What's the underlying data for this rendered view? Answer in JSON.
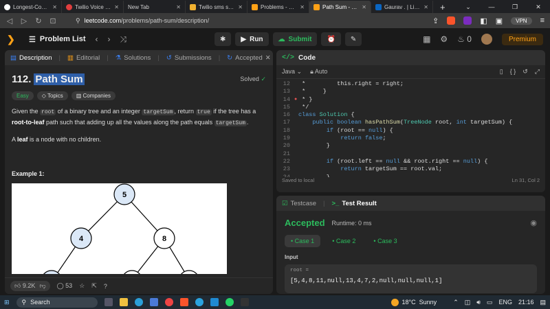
{
  "browser": {
    "tabs": [
      {
        "title": "Longest-Compound",
        "color": "#ffffff"
      },
      {
        "title": "Twilio Voice SDKs -",
        "color": "#e03e3e"
      },
      {
        "title": "New Tab",
        "color": "#333333"
      },
      {
        "title": "Twilio sms sender a",
        "color": "#f0b030"
      },
      {
        "title": "Problems - LeetCod",
        "color": "#ffa116"
      },
      {
        "title": "Path Sum - Leet",
        "color": "#ffa116"
      },
      {
        "title": "Gaurav . | LinkedIn",
        "color": "#0a66c2"
      }
    ],
    "new_tab": "+",
    "url_domain": "leetcode.com",
    "url_path": "/problems/path-sum/description/",
    "vpn_label": "VPN",
    "brave_badge": "1"
  },
  "lc": {
    "problem_list": "Problem List",
    "run": "Run",
    "submit": "Submit",
    "streak": "0",
    "premium": "Premium"
  },
  "left": {
    "tabs": [
      "Description",
      "Editorial",
      "Solutions",
      "Submissions",
      "Accepted"
    ],
    "number": "112.",
    "title": "Path Sum",
    "solved": "Solved",
    "tags": [
      "Easy",
      "Topics",
      "Companies"
    ],
    "para1_a": "Given the ",
    "para1_root": "root",
    "para1_b": " of a binary tree and an integer ",
    "para1_ts": "targetSum",
    "para1_c": ", return ",
    "para1_true": "true",
    "para1_d": " if the tree has a ",
    "para1_bold": "root-to-leaf",
    "para1_e": " path such that adding up all the values along the path equals ",
    "para1_ts2": "targetSum",
    "para1_f": ".",
    "para2_a": "A ",
    "para2_leaf": "leaf",
    "para2_b": " is a node with no children.",
    "example": "Example 1:",
    "tree_nodes": [
      "5",
      "4",
      "8"
    ],
    "likes": "9.2K",
    "comments": "53"
  },
  "code": {
    "header": "Code",
    "language": "Java",
    "mode": "Auto",
    "lines": [
      {
        "n": "12",
        "t": " *         this.right = right;"
      },
      {
        "n": "13",
        "t": " *     }"
      },
      {
        "n": "14",
        "t": " * }"
      },
      {
        "n": "15",
        "t": " */"
      },
      {
        "n": "16",
        "t": "class Solution {"
      },
      {
        "n": "17",
        "t": "    public boolean hasPathSum(TreeNode root, int targetSum) {"
      },
      {
        "n": "18",
        "t": "        if (root == null) {"
      },
      {
        "n": "19",
        "t": "            return false;"
      },
      {
        "n": "20",
        "t": "        }"
      },
      {
        "n": "21",
        "t": ""
      },
      {
        "n": "22",
        "t": "        if (root.left == null && root.right == null) {"
      },
      {
        "n": "23",
        "t": "            return targetSum == root.val;"
      },
      {
        "n": "24",
        "t": "        }"
      }
    ],
    "saved": "Saved to local",
    "cursor": "Ln 31, Col 2"
  },
  "result": {
    "tabs": [
      "Testcase",
      "Test Result"
    ],
    "status": "Accepted",
    "runtime": "Runtime: 0 ms",
    "cases": [
      "Case 1",
      "Case 2",
      "Case 3"
    ],
    "input_label": "Input",
    "input_key": "root =",
    "input_value": "[5,4,8,11,null,13,4,7,2,null,null,null,1]"
  },
  "taskbar": {
    "search": "Search",
    "temp": "18°C",
    "weather": "Sunny",
    "lang": "ENG",
    "time": "21:16"
  }
}
